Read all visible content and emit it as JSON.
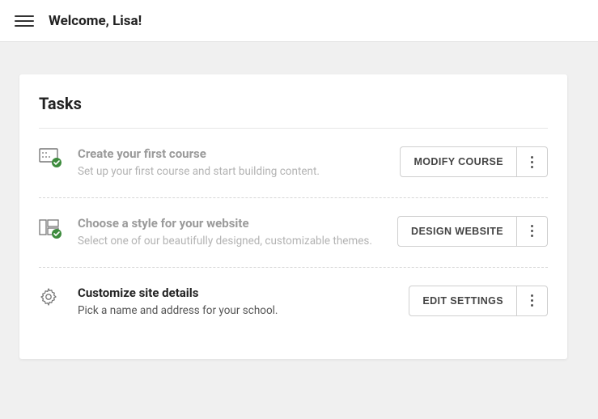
{
  "header": {
    "welcome": "Welcome, Lisa!"
  },
  "card": {
    "title": "Tasks"
  },
  "tasks": [
    {
      "title": "Create your first course",
      "desc": "Set up your first course and start building content.",
      "button": "MODIFY COURSE",
      "completed": true
    },
    {
      "title": "Choose a style for your website",
      "desc": "Select one of our beautifully designed, customizable themes.",
      "button": "DESIGN WEBSITE",
      "completed": true
    },
    {
      "title": "Customize site details",
      "desc": "Pick a name and address for your school.",
      "button": "EDIT SETTINGS",
      "completed": false
    }
  ]
}
